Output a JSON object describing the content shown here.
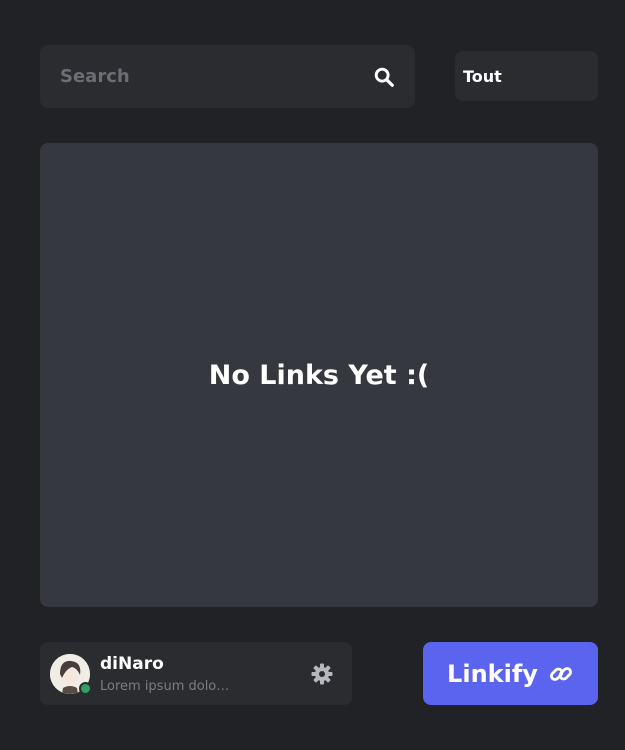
{
  "search": {
    "placeholder": "Search",
    "icon": "search-icon"
  },
  "filter": {
    "selected": "Tout"
  },
  "links_panel": {
    "empty_message": "No Links Yet :("
  },
  "user": {
    "name": "diNaro",
    "status_text": "Lorem ipsum dolor sit amet",
    "online": true,
    "settings_icon": "gear-icon"
  },
  "action": {
    "label": "Linkify",
    "icon": "link-icon"
  },
  "colors": {
    "background": "#202225",
    "surface": "#2b2c30",
    "panel": "#36383f",
    "accent": "#5b64ee",
    "online": "#2fa160"
  }
}
